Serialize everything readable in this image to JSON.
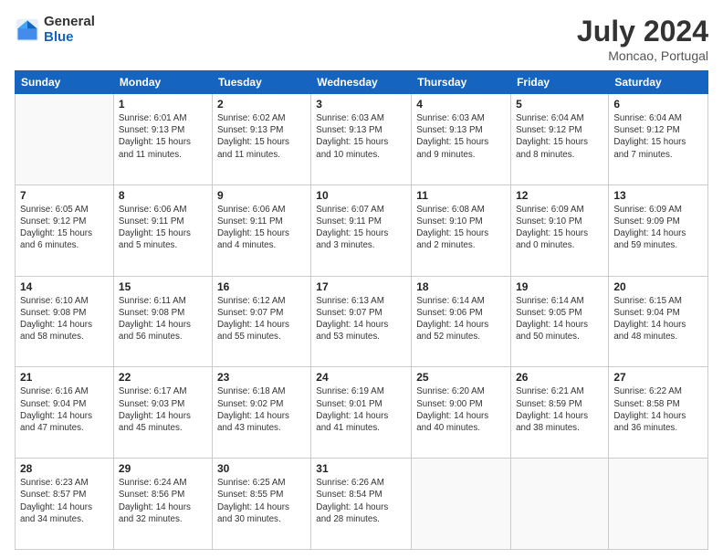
{
  "header": {
    "logo": {
      "line1": "General",
      "line2": "Blue"
    },
    "title": "July 2024",
    "location": "Moncao, Portugal"
  },
  "weekdays": [
    "Sunday",
    "Monday",
    "Tuesday",
    "Wednesday",
    "Thursday",
    "Friday",
    "Saturday"
  ],
  "weeks": [
    [
      {
        "day": "",
        "info": ""
      },
      {
        "day": "1",
        "info": "Sunrise: 6:01 AM\nSunset: 9:13 PM\nDaylight: 15 hours\nand 11 minutes."
      },
      {
        "day": "2",
        "info": "Sunrise: 6:02 AM\nSunset: 9:13 PM\nDaylight: 15 hours\nand 11 minutes."
      },
      {
        "day": "3",
        "info": "Sunrise: 6:03 AM\nSunset: 9:13 PM\nDaylight: 15 hours\nand 10 minutes."
      },
      {
        "day": "4",
        "info": "Sunrise: 6:03 AM\nSunset: 9:13 PM\nDaylight: 15 hours\nand 9 minutes."
      },
      {
        "day": "5",
        "info": "Sunrise: 6:04 AM\nSunset: 9:12 PM\nDaylight: 15 hours\nand 8 minutes."
      },
      {
        "day": "6",
        "info": "Sunrise: 6:04 AM\nSunset: 9:12 PM\nDaylight: 15 hours\nand 7 minutes."
      }
    ],
    [
      {
        "day": "7",
        "info": "Sunrise: 6:05 AM\nSunset: 9:12 PM\nDaylight: 15 hours\nand 6 minutes."
      },
      {
        "day": "8",
        "info": "Sunrise: 6:06 AM\nSunset: 9:11 PM\nDaylight: 15 hours\nand 5 minutes."
      },
      {
        "day": "9",
        "info": "Sunrise: 6:06 AM\nSunset: 9:11 PM\nDaylight: 15 hours\nand 4 minutes."
      },
      {
        "day": "10",
        "info": "Sunrise: 6:07 AM\nSunset: 9:11 PM\nDaylight: 15 hours\nand 3 minutes."
      },
      {
        "day": "11",
        "info": "Sunrise: 6:08 AM\nSunset: 9:10 PM\nDaylight: 15 hours\nand 2 minutes."
      },
      {
        "day": "12",
        "info": "Sunrise: 6:09 AM\nSunset: 9:10 PM\nDaylight: 15 hours\nand 0 minutes."
      },
      {
        "day": "13",
        "info": "Sunrise: 6:09 AM\nSunset: 9:09 PM\nDaylight: 14 hours\nand 59 minutes."
      }
    ],
    [
      {
        "day": "14",
        "info": "Sunrise: 6:10 AM\nSunset: 9:08 PM\nDaylight: 14 hours\nand 58 minutes."
      },
      {
        "day": "15",
        "info": "Sunrise: 6:11 AM\nSunset: 9:08 PM\nDaylight: 14 hours\nand 56 minutes."
      },
      {
        "day": "16",
        "info": "Sunrise: 6:12 AM\nSunset: 9:07 PM\nDaylight: 14 hours\nand 55 minutes."
      },
      {
        "day": "17",
        "info": "Sunrise: 6:13 AM\nSunset: 9:07 PM\nDaylight: 14 hours\nand 53 minutes."
      },
      {
        "day": "18",
        "info": "Sunrise: 6:14 AM\nSunset: 9:06 PM\nDaylight: 14 hours\nand 52 minutes."
      },
      {
        "day": "19",
        "info": "Sunrise: 6:14 AM\nSunset: 9:05 PM\nDaylight: 14 hours\nand 50 minutes."
      },
      {
        "day": "20",
        "info": "Sunrise: 6:15 AM\nSunset: 9:04 PM\nDaylight: 14 hours\nand 48 minutes."
      }
    ],
    [
      {
        "day": "21",
        "info": "Sunrise: 6:16 AM\nSunset: 9:04 PM\nDaylight: 14 hours\nand 47 minutes."
      },
      {
        "day": "22",
        "info": "Sunrise: 6:17 AM\nSunset: 9:03 PM\nDaylight: 14 hours\nand 45 minutes."
      },
      {
        "day": "23",
        "info": "Sunrise: 6:18 AM\nSunset: 9:02 PM\nDaylight: 14 hours\nand 43 minutes."
      },
      {
        "day": "24",
        "info": "Sunrise: 6:19 AM\nSunset: 9:01 PM\nDaylight: 14 hours\nand 41 minutes."
      },
      {
        "day": "25",
        "info": "Sunrise: 6:20 AM\nSunset: 9:00 PM\nDaylight: 14 hours\nand 40 minutes."
      },
      {
        "day": "26",
        "info": "Sunrise: 6:21 AM\nSunset: 8:59 PM\nDaylight: 14 hours\nand 38 minutes."
      },
      {
        "day": "27",
        "info": "Sunrise: 6:22 AM\nSunset: 8:58 PM\nDaylight: 14 hours\nand 36 minutes."
      }
    ],
    [
      {
        "day": "28",
        "info": "Sunrise: 6:23 AM\nSunset: 8:57 PM\nDaylight: 14 hours\nand 34 minutes."
      },
      {
        "day": "29",
        "info": "Sunrise: 6:24 AM\nSunset: 8:56 PM\nDaylight: 14 hours\nand 32 minutes."
      },
      {
        "day": "30",
        "info": "Sunrise: 6:25 AM\nSunset: 8:55 PM\nDaylight: 14 hours\nand 30 minutes."
      },
      {
        "day": "31",
        "info": "Sunrise: 6:26 AM\nSunset: 8:54 PM\nDaylight: 14 hours\nand 28 minutes."
      },
      {
        "day": "",
        "info": ""
      },
      {
        "day": "",
        "info": ""
      },
      {
        "day": "",
        "info": ""
      }
    ]
  ]
}
